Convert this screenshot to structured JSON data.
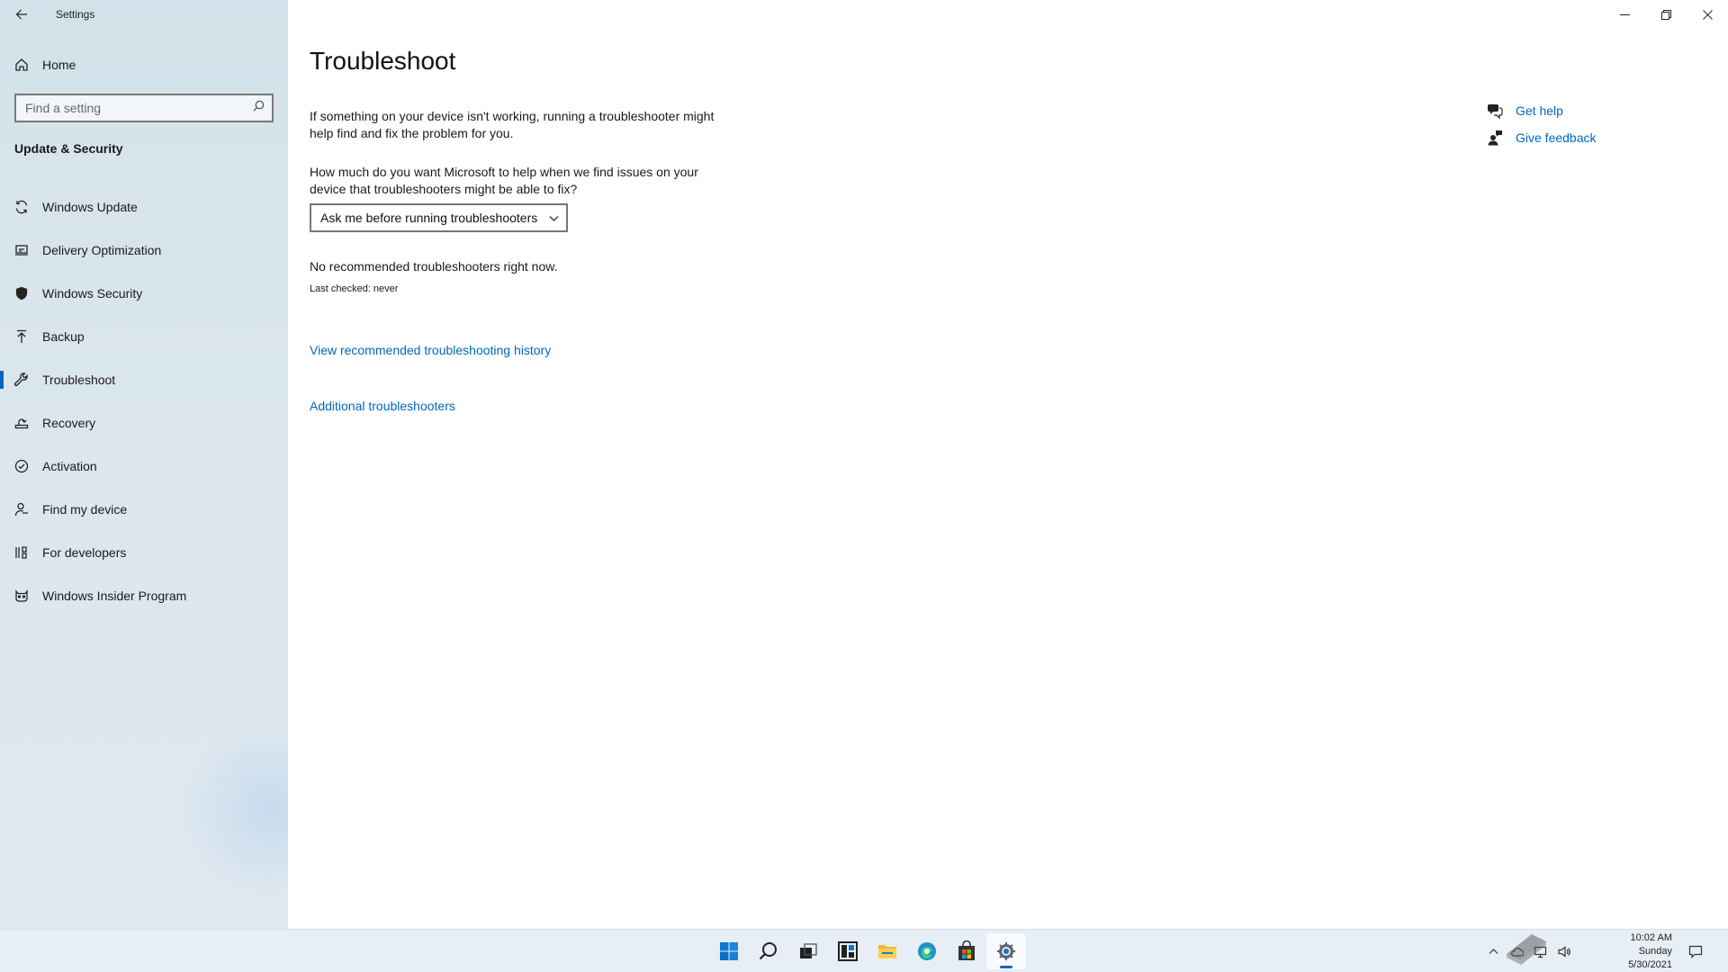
{
  "window": {
    "app_title": "Settings",
    "minimize": "minimize",
    "restore": "restore",
    "close": "close"
  },
  "sidebar": {
    "home_label": "Home",
    "search_placeholder": "Find a setting",
    "section_title": "Update & Security",
    "items": [
      {
        "label": "Windows Update",
        "icon": "sync-icon"
      },
      {
        "label": "Delivery Optimization",
        "icon": "delivery-optimization-icon"
      },
      {
        "label": "Windows Security",
        "icon": "shield-icon"
      },
      {
        "label": "Backup",
        "icon": "backup-arrow-icon"
      },
      {
        "label": "Troubleshoot",
        "icon": "wrench-icon",
        "selected": true
      },
      {
        "label": "Recovery",
        "icon": "recovery-icon"
      },
      {
        "label": "Activation",
        "icon": "check-circle-icon"
      },
      {
        "label": "Find my device",
        "icon": "person-location-icon"
      },
      {
        "label": "For developers",
        "icon": "developer-icon"
      },
      {
        "label": "Windows Insider Program",
        "icon": "insider-cat-icon"
      }
    ]
  },
  "main": {
    "title": "Troubleshoot",
    "description": "If something on your device isn't working, running a troubleshooter might help find and fix the problem for you.",
    "question": "How much do you want Microsoft to help when we find issues on your device that troubleshooters might be able to fix?",
    "dropdown_value": "Ask me before running troubleshooters",
    "status": "No recommended troubleshooters right now.",
    "last_checked": "Last checked: never",
    "link_history": "View recommended troubleshooting history",
    "link_additional": "Additional troubleshooters"
  },
  "help": {
    "get_help": "Get help",
    "give_feedback": "Give feedback"
  },
  "taskbar": {
    "time": "10:02 AM",
    "day": "Sunday",
    "date": "5/30/2021",
    "apps": [
      "start-icon",
      "search-icon",
      "task-view-icon",
      "widgets-icon",
      "file-explorer-icon",
      "edge-icon",
      "store-icon",
      "settings-icon"
    ],
    "active_app": "settings-icon"
  },
  "colors": {
    "accent": "#0067c0",
    "sidebar_bg": "#d9e5ed",
    "taskbar_bg": "#e8eef5"
  }
}
